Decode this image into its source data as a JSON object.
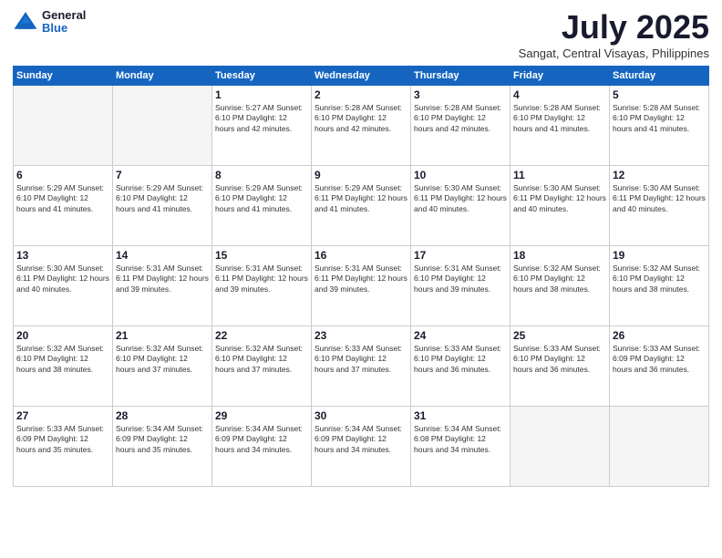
{
  "header": {
    "logo": {
      "general": "General",
      "blue": "Blue"
    },
    "title": "July 2025",
    "location": "Sangat, Central Visayas, Philippines"
  },
  "weekdays": [
    "Sunday",
    "Monday",
    "Tuesday",
    "Wednesday",
    "Thursday",
    "Friday",
    "Saturday"
  ],
  "weeks": [
    [
      {
        "day": "",
        "info": ""
      },
      {
        "day": "",
        "info": ""
      },
      {
        "day": "1",
        "info": "Sunrise: 5:27 AM\nSunset: 6:10 PM\nDaylight: 12 hours\nand 42 minutes."
      },
      {
        "day": "2",
        "info": "Sunrise: 5:28 AM\nSunset: 6:10 PM\nDaylight: 12 hours\nand 42 minutes."
      },
      {
        "day": "3",
        "info": "Sunrise: 5:28 AM\nSunset: 6:10 PM\nDaylight: 12 hours\nand 42 minutes."
      },
      {
        "day": "4",
        "info": "Sunrise: 5:28 AM\nSunset: 6:10 PM\nDaylight: 12 hours\nand 41 minutes."
      },
      {
        "day": "5",
        "info": "Sunrise: 5:28 AM\nSunset: 6:10 PM\nDaylight: 12 hours\nand 41 minutes."
      }
    ],
    [
      {
        "day": "6",
        "info": "Sunrise: 5:29 AM\nSunset: 6:10 PM\nDaylight: 12 hours\nand 41 minutes."
      },
      {
        "day": "7",
        "info": "Sunrise: 5:29 AM\nSunset: 6:10 PM\nDaylight: 12 hours\nand 41 minutes."
      },
      {
        "day": "8",
        "info": "Sunrise: 5:29 AM\nSunset: 6:10 PM\nDaylight: 12 hours\nand 41 minutes."
      },
      {
        "day": "9",
        "info": "Sunrise: 5:29 AM\nSunset: 6:11 PM\nDaylight: 12 hours\nand 41 minutes."
      },
      {
        "day": "10",
        "info": "Sunrise: 5:30 AM\nSunset: 6:11 PM\nDaylight: 12 hours\nand 40 minutes."
      },
      {
        "day": "11",
        "info": "Sunrise: 5:30 AM\nSunset: 6:11 PM\nDaylight: 12 hours\nand 40 minutes."
      },
      {
        "day": "12",
        "info": "Sunrise: 5:30 AM\nSunset: 6:11 PM\nDaylight: 12 hours\nand 40 minutes."
      }
    ],
    [
      {
        "day": "13",
        "info": "Sunrise: 5:30 AM\nSunset: 6:11 PM\nDaylight: 12 hours\nand 40 minutes."
      },
      {
        "day": "14",
        "info": "Sunrise: 5:31 AM\nSunset: 6:11 PM\nDaylight: 12 hours\nand 39 minutes."
      },
      {
        "day": "15",
        "info": "Sunrise: 5:31 AM\nSunset: 6:11 PM\nDaylight: 12 hours\nand 39 minutes."
      },
      {
        "day": "16",
        "info": "Sunrise: 5:31 AM\nSunset: 6:11 PM\nDaylight: 12 hours\nand 39 minutes."
      },
      {
        "day": "17",
        "info": "Sunrise: 5:31 AM\nSunset: 6:10 PM\nDaylight: 12 hours\nand 39 minutes."
      },
      {
        "day": "18",
        "info": "Sunrise: 5:32 AM\nSunset: 6:10 PM\nDaylight: 12 hours\nand 38 minutes."
      },
      {
        "day": "19",
        "info": "Sunrise: 5:32 AM\nSunset: 6:10 PM\nDaylight: 12 hours\nand 38 minutes."
      }
    ],
    [
      {
        "day": "20",
        "info": "Sunrise: 5:32 AM\nSunset: 6:10 PM\nDaylight: 12 hours\nand 38 minutes."
      },
      {
        "day": "21",
        "info": "Sunrise: 5:32 AM\nSunset: 6:10 PM\nDaylight: 12 hours\nand 37 minutes."
      },
      {
        "day": "22",
        "info": "Sunrise: 5:32 AM\nSunset: 6:10 PM\nDaylight: 12 hours\nand 37 minutes."
      },
      {
        "day": "23",
        "info": "Sunrise: 5:33 AM\nSunset: 6:10 PM\nDaylight: 12 hours\nand 37 minutes."
      },
      {
        "day": "24",
        "info": "Sunrise: 5:33 AM\nSunset: 6:10 PM\nDaylight: 12 hours\nand 36 minutes."
      },
      {
        "day": "25",
        "info": "Sunrise: 5:33 AM\nSunset: 6:10 PM\nDaylight: 12 hours\nand 36 minutes."
      },
      {
        "day": "26",
        "info": "Sunrise: 5:33 AM\nSunset: 6:09 PM\nDaylight: 12 hours\nand 36 minutes."
      }
    ],
    [
      {
        "day": "27",
        "info": "Sunrise: 5:33 AM\nSunset: 6:09 PM\nDaylight: 12 hours\nand 35 minutes."
      },
      {
        "day": "28",
        "info": "Sunrise: 5:34 AM\nSunset: 6:09 PM\nDaylight: 12 hours\nand 35 minutes."
      },
      {
        "day": "29",
        "info": "Sunrise: 5:34 AM\nSunset: 6:09 PM\nDaylight: 12 hours\nand 34 minutes."
      },
      {
        "day": "30",
        "info": "Sunrise: 5:34 AM\nSunset: 6:09 PM\nDaylight: 12 hours\nand 34 minutes."
      },
      {
        "day": "31",
        "info": "Sunrise: 5:34 AM\nSunset: 6:08 PM\nDaylight: 12 hours\nand 34 minutes."
      },
      {
        "day": "",
        "info": ""
      },
      {
        "day": "",
        "info": ""
      }
    ]
  ]
}
